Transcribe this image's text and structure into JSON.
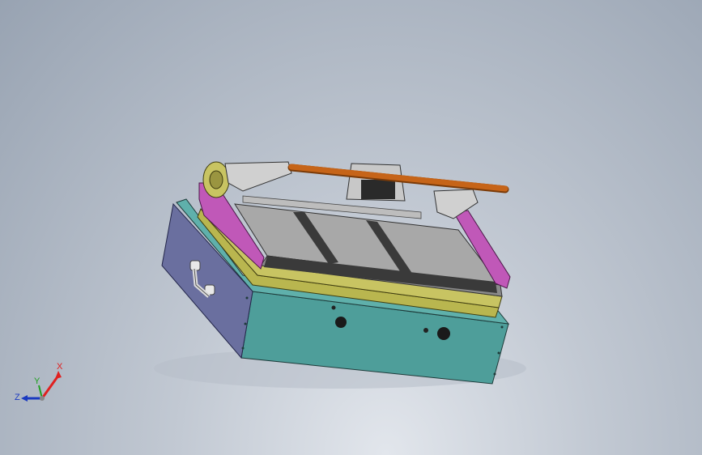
{
  "viewport": {
    "background_top": "#98a3b2",
    "background_bottom": "#e2e6ec"
  },
  "model": {
    "parts": {
      "base_housing": "#4e9e9a",
      "side_panel": "#6a6f9f",
      "magenta_plates": "#c058b8",
      "yellow_plates": "#b9b64f",
      "gray_platform": "#9a9a9a",
      "dark_strips": "#3a3a3a",
      "handle_bar": "#c66418"
    },
    "icons": [
      "gear-icon",
      "handle-icon",
      "knob-icon"
    ]
  },
  "triad": {
    "x_label": "X",
    "y_label": "Y",
    "z_label": "Z",
    "x_color": "#e02020",
    "y_color": "#20a020",
    "z_color": "#1a3ac0"
  }
}
